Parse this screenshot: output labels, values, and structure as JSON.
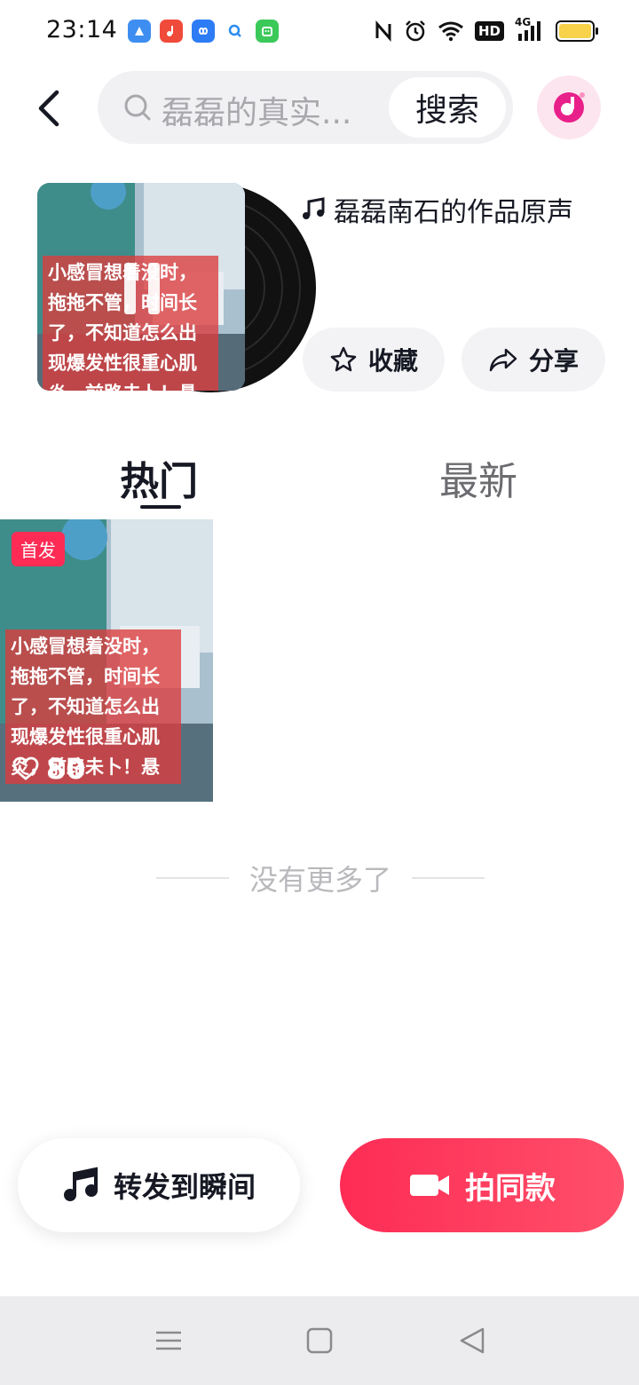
{
  "status_bar": {
    "time": "23:14",
    "hd_label": "HD",
    "network_label": "4G",
    "battery_level": 1.0
  },
  "header": {
    "search_query": "磊磊的真实...",
    "search_button_label": "搜索"
  },
  "sound": {
    "title": "磊磊南石的作品原声",
    "favorite_label": "收藏",
    "share_label": "分享",
    "cover_caption": "小感冒想着没时，拖拖不管，时间长了，不知道怎么出现爆发性很重心肌炎，前路未卜！悬"
  },
  "tabs": [
    {
      "label": "热门",
      "active": true
    },
    {
      "label": "最新",
      "active": false
    }
  ],
  "videos": [
    {
      "badge": "首发",
      "caption": "小感冒想着没时，拖拖不管，时间长了，不知道怎么出现爆发性很重心肌炎，前路未卜！悬",
      "likes": "80"
    }
  ],
  "end_text": "没有更多了",
  "actions": {
    "share_moment_label": "转发到瞬间",
    "shoot_same_label": "拍同款"
  },
  "colors": {
    "accent": "#fe2c55",
    "text_primary": "#161823",
    "search_bg": "#f1f1f3",
    "battery": "#f7d24a"
  },
  "icons": {
    "back": "chevron-left-icon",
    "search": "search-icon",
    "music_note": "music-note-icon",
    "star": "star-icon",
    "share": "share-arrow-icon",
    "heart": "heart-icon",
    "camera": "camera-icon",
    "nav_menu": "menu-icon",
    "nav_home": "home-icon",
    "nav_back": "back-triangle-icon"
  }
}
